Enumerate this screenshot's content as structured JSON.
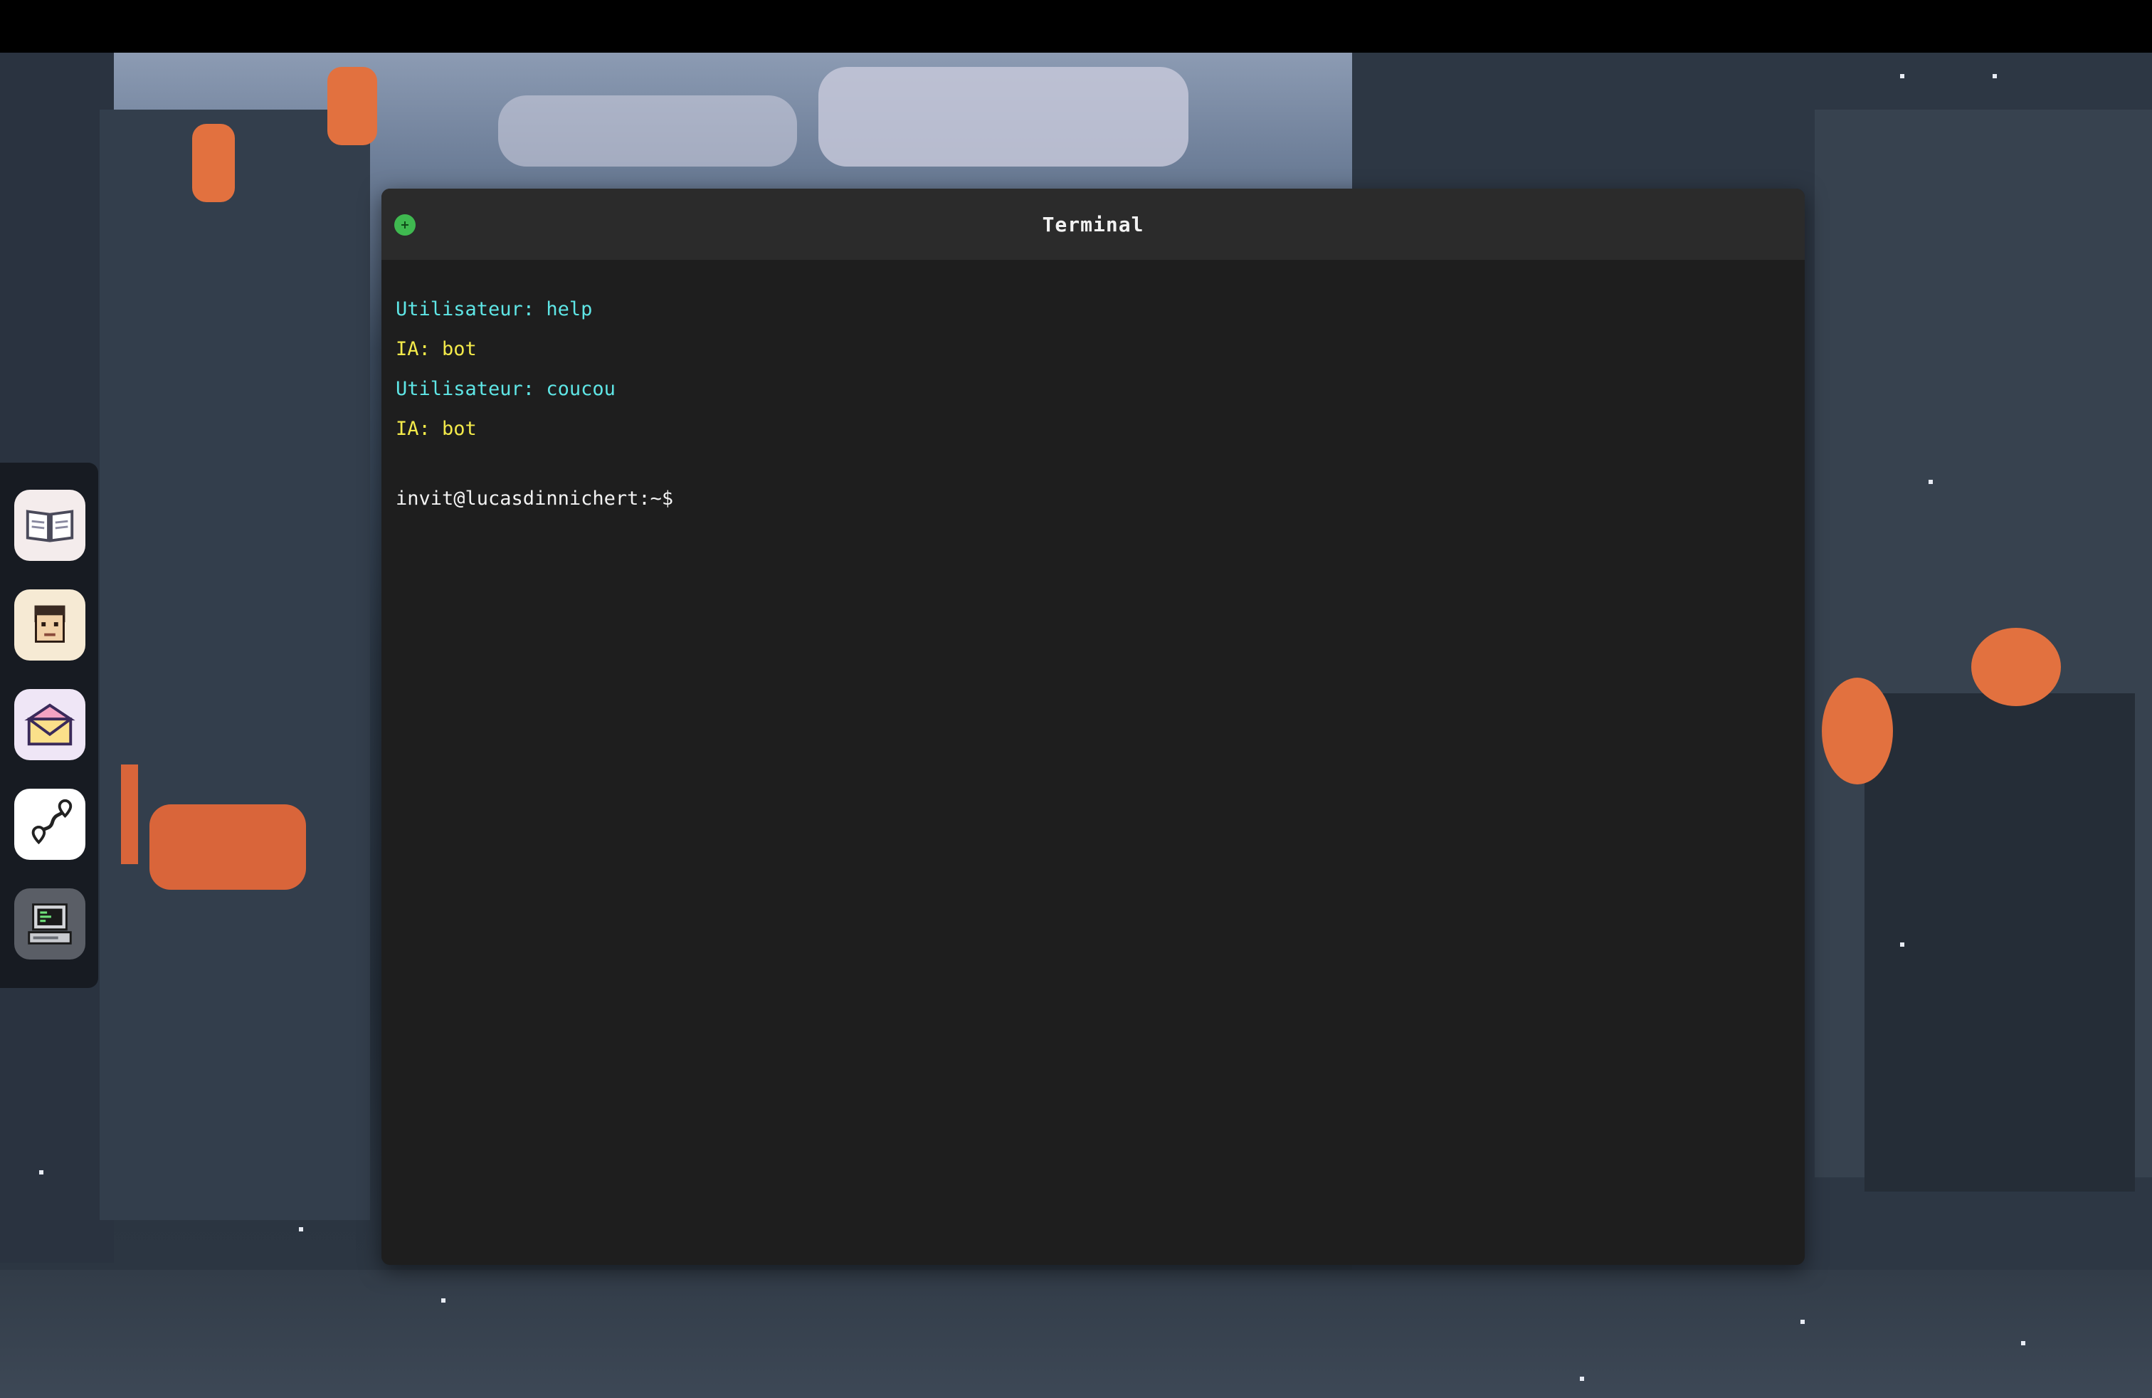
{
  "window": {
    "title": "Terminal"
  },
  "terminal": {
    "lines": [
      {
        "role": "user",
        "text": "Utilisateur: help"
      },
      {
        "role": "ia",
        "text": "IA: bot"
      },
      {
        "role": "user",
        "text": "Utilisateur: coucou"
      },
      {
        "role": "ia",
        "text": "IA: bot"
      }
    ],
    "prompt": "invit@lucasdinnichert:~$",
    "input_value": ""
  },
  "dock": {
    "apps": [
      {
        "icon": "book-icon"
      },
      {
        "icon": "profile-face-icon"
      },
      {
        "icon": "mail-envelope-icon"
      },
      {
        "icon": "map-route-icon"
      },
      {
        "icon": "computer-terminal-icon"
      }
    ]
  },
  "colors": {
    "user_line": "#5fe6e6",
    "ia_line": "#f3ea4a",
    "terminal_bg": "#1e1e1e",
    "titlebar_bg": "#2b2b2b",
    "maximize_button": "#3fb950"
  }
}
